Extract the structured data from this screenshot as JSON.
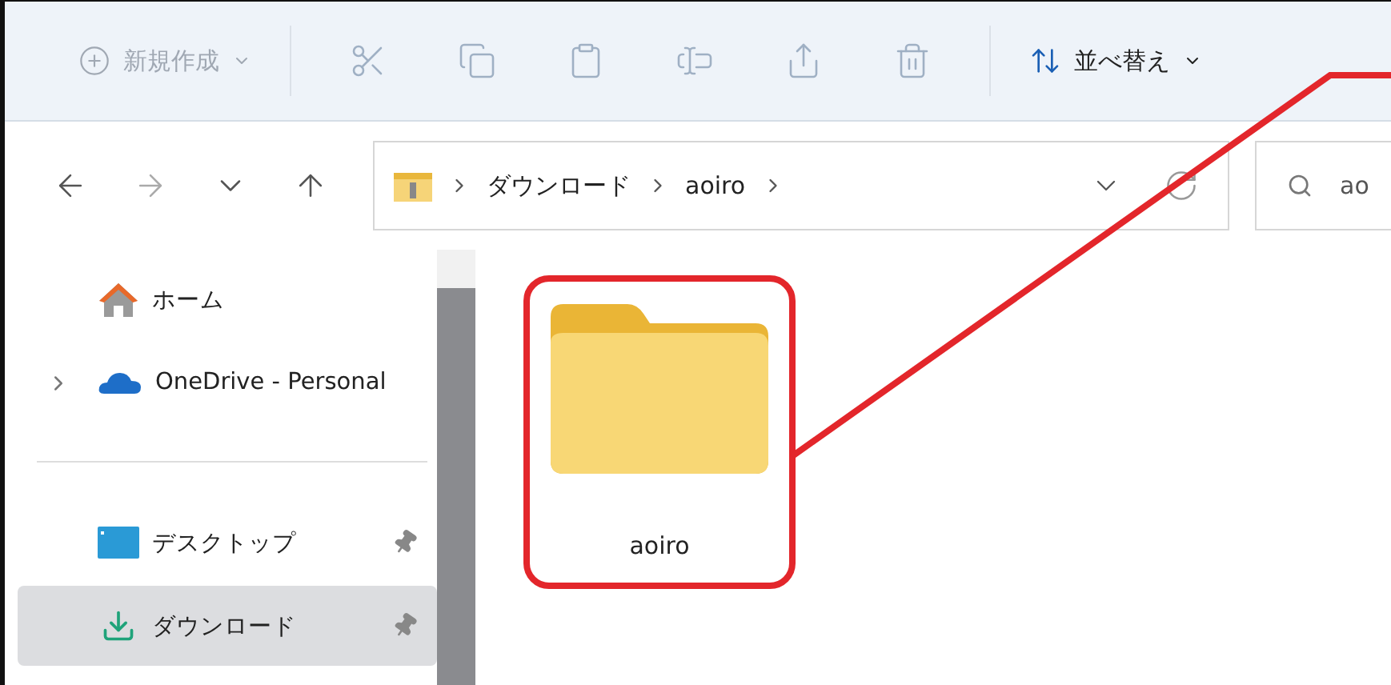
{
  "toolbar": {
    "new_button": {
      "label": "新規作成",
      "disabled": true
    },
    "actions": [
      {
        "kind": "cut",
        "disabled": true
      },
      {
        "kind": "copy",
        "disabled": true
      },
      {
        "kind": "paste",
        "disabled": true
      },
      {
        "kind": "rename",
        "disabled": true
      },
      {
        "kind": "share",
        "disabled": true
      },
      {
        "kind": "delete",
        "disabled": true
      }
    ],
    "sort_button": {
      "label": "並べ替え",
      "disabled": false
    }
  },
  "nav": [
    {
      "kind": "back",
      "disabled": false
    },
    {
      "kind": "forward",
      "disabled": true
    },
    {
      "kind": "recent",
      "disabled": false
    },
    {
      "kind": "up",
      "disabled": false
    }
  ],
  "address_bar": {
    "path": [
      "ダウンロード",
      "aoiro"
    ]
  },
  "search": {
    "value": "ao"
  },
  "sidebar": {
    "items": [
      {
        "kind": "home",
        "label": "ホーム",
        "selected": false,
        "expandable": false
      },
      {
        "kind": "onedrive",
        "label": "OneDrive - Personal",
        "selected": false,
        "expandable": true
      }
    ],
    "pinned": [
      {
        "kind": "desktop",
        "label": "デスクトップ",
        "selected": false,
        "pinned": true
      },
      {
        "kind": "downloads",
        "label": "ダウンロード",
        "selected": true,
        "pinned": true
      }
    ]
  },
  "files": [
    {
      "name": "aoiro",
      "highlighted": true
    }
  ]
}
